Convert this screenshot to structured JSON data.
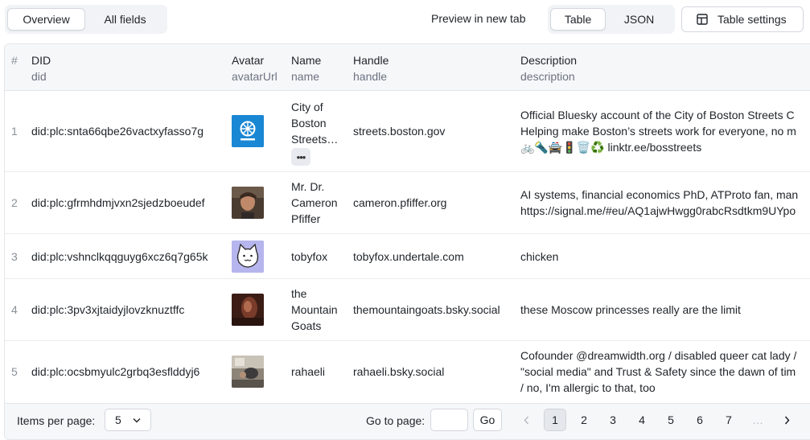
{
  "toolbar": {
    "view_tabs": [
      "Overview",
      "All fields"
    ],
    "preview_link": "Preview in new tab",
    "format_tabs": [
      "Table",
      "JSON"
    ],
    "table_settings": "Table settings"
  },
  "table": {
    "columns": [
      {
        "label": "#",
        "key": ""
      },
      {
        "label": "DID",
        "key": "did"
      },
      {
        "label": "Avatar",
        "key": "avatarUrl"
      },
      {
        "label": "Name",
        "key": "name"
      },
      {
        "label": "Handle",
        "key": "handle"
      },
      {
        "label": "Description",
        "key": "description"
      }
    ],
    "rows": [
      {
        "index": "1",
        "did": "did:plc:snta66qbe26vactxyfasso7g",
        "name_lines": [
          "City of",
          "Boston",
          "Streets…"
        ],
        "handle": "streets.boston.gov",
        "desc_lines": [
          "Official Bluesky account of the City of Boston Streets C",
          "Helping make Boston’s streets work for everyone, no m",
          "🚲🔦🚔🚦🗑️♻️ linktr.ee/bosstreets"
        ],
        "more": "•••"
      },
      {
        "index": "2",
        "did": "did:plc:gfrmhdmjvxn2sjedzboeudef",
        "name_lines": [
          "Mr. Dr.",
          "Cameron",
          "Pfiffer"
        ],
        "handle": "cameron.pfiffer.org",
        "desc_lines": [
          "AI systems, financial economics PhD, ATProto fan, man",
          "https://signal.me/#eu/AQ1ajwHwgg0rabcRsdtkm9UYpo"
        ]
      },
      {
        "index": "3",
        "did": "did:plc:vshnclkqqguyg6xcz6q7g65k",
        "name_lines": [
          "tobyfox"
        ],
        "handle": "tobyfox.undertale.com",
        "desc_lines": [
          "chicken"
        ]
      },
      {
        "index": "4",
        "did": "did:plc:3pv3xjtaidyjlovzknuztffc",
        "name_lines": [
          "the",
          "Mountain",
          "Goats"
        ],
        "handle": "themountaingoats.bsky.social",
        "desc_lines": [
          "these Moscow princesses really are the limit"
        ]
      },
      {
        "index": "5",
        "did": "did:plc:ocsbmyulc2grbq3esflddyj6",
        "name_lines": [
          "rahaeli"
        ],
        "handle": "rahaeli.bsky.social",
        "desc_lines": [
          "Cofounder @dreamwidth.org / disabled queer cat lady /",
          "\"social media\" and Trust & Safety since the dawn of tim",
          "/ no, I'm allergic to that, too"
        ]
      }
    ]
  },
  "footer": {
    "items_per_page_label": "Items per page:",
    "items_per_page_value": "5",
    "go_to_page_label": "Go to page:",
    "go_to_page_value": "",
    "go_button": "Go",
    "pages": [
      "1",
      "2",
      "3",
      "4",
      "5",
      "6",
      "7"
    ],
    "current_page": "1",
    "ellipsis": "…",
    "prev_icon": "chevron-left-icon",
    "next_icon": "chevron-right-icon"
  }
}
